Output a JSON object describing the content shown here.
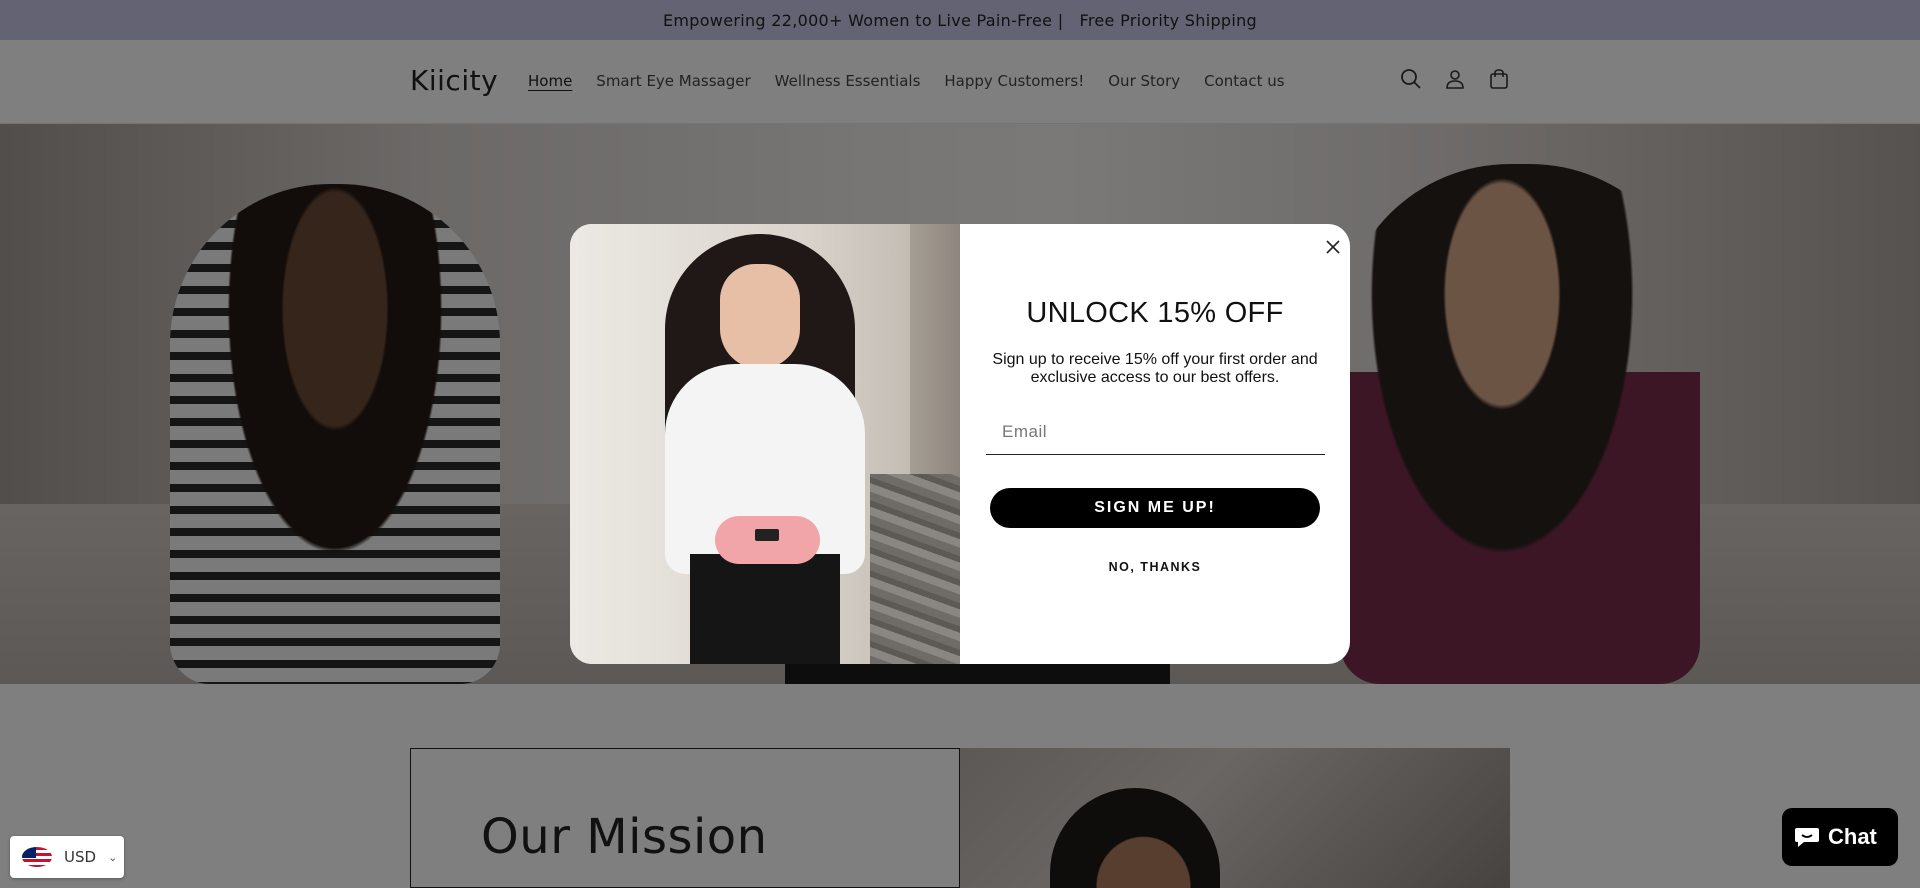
{
  "announcement": {
    "text": "Empowering 22,000+ Women to Live Pain-Free |   Free Priority Shipping"
  },
  "header": {
    "logo": "Kiicity",
    "nav": [
      {
        "label": "Home",
        "active": true
      },
      {
        "label": "Smart Eye Massager"
      },
      {
        "label": "Wellness Essentials"
      },
      {
        "label": "Happy Customers!"
      },
      {
        "label": "Our Story"
      },
      {
        "label": "Contact us"
      }
    ],
    "icons": [
      "search-icon",
      "account-icon",
      "cart-icon"
    ]
  },
  "mission": {
    "title": "Our Mission"
  },
  "popup": {
    "title": "UNLOCK 15% OFF",
    "subtitle": "Sign up to receive 15% off your first order and exclusive access to our best offers.",
    "email_placeholder": "Email",
    "submit_label": "SIGN ME UP!",
    "decline_label": "NO, THANKS",
    "close_icon": "close-icon"
  },
  "currency": {
    "code": "USD",
    "flag": "us-flag-icon"
  },
  "chat": {
    "label": "Chat"
  },
  "colors": {
    "announcement_bg": "#c9c6e8",
    "button_bg": "#000000",
    "overlay": "rgba(0,0,0,0.5)"
  }
}
